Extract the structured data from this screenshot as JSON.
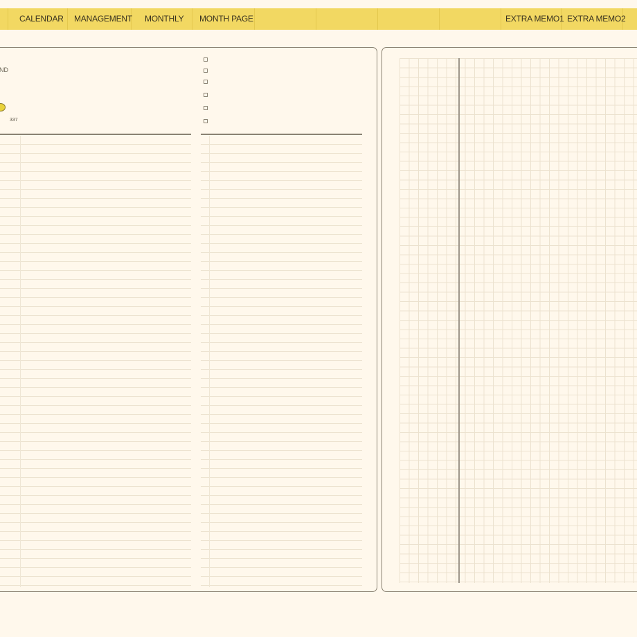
{
  "nav": {
    "tabs": [
      {
        "label": "CALENDAR"
      },
      {
        "label": "MANAGEMENT"
      },
      {
        "label": "MONTHLY"
      },
      {
        "label": "MONTH PAGE"
      }
    ],
    "extras": [
      {
        "label": "EXTRA MEMO1"
      },
      {
        "label": "EXTRA MEMO2"
      }
    ]
  },
  "left_panel": {
    "partial_label": "ND",
    "day_count": "337"
  },
  "colors": {
    "nav_bg": "#f2d862",
    "page_bg": "#fff8ec",
    "border": "#8a8272",
    "moon": "#e9d23a"
  },
  "icons": [
    "moon-phase-icon",
    "checkbox-icon"
  ]
}
